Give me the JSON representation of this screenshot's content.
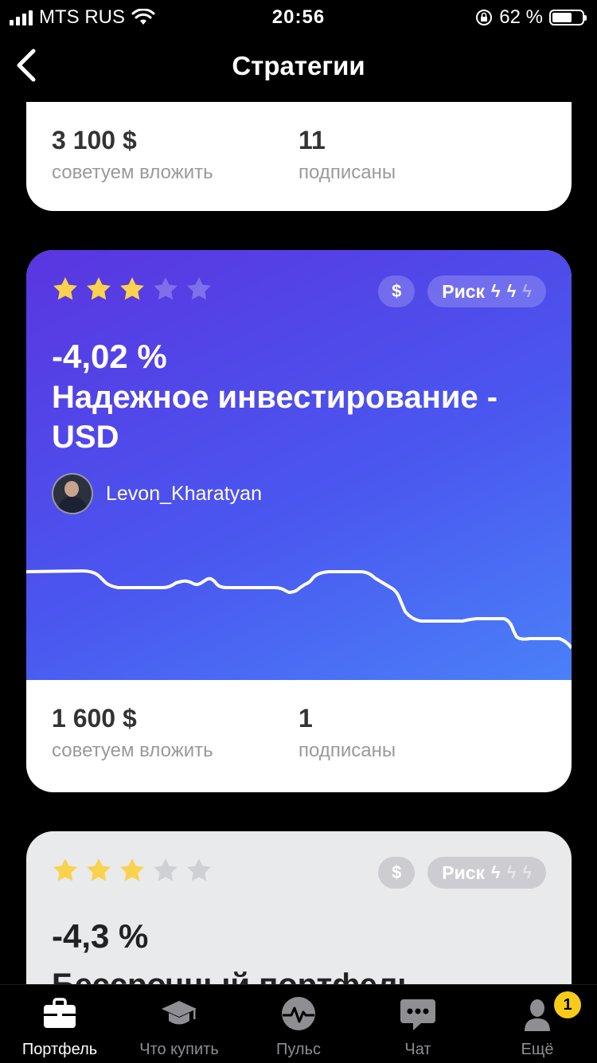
{
  "status": {
    "carrier": "MTS RUS",
    "time": "20:56",
    "battery": "62 %"
  },
  "nav": {
    "title": "Стратегии"
  },
  "cards": [
    {
      "amount": "3 100 $",
      "amount_label": "советуем вложить",
      "subs": "11",
      "subs_label": "подписаны"
    },
    {
      "rating": 3,
      "currency": "$",
      "risk_label": "Риск",
      "risk_level": 2,
      "percent": "-4,02 %",
      "name": "Надежное инвестирование - USD",
      "author": "Levon_Kharatyan",
      "amount": "1 600 $",
      "amount_label": "советуем вложить",
      "subs": "1",
      "subs_label": "подписаны"
    },
    {
      "rating": 3,
      "currency": "$",
      "risk_label": "Риск",
      "risk_level": 1,
      "percent": "-4,3 %",
      "name": "Бессрочный портфель"
    }
  ],
  "tabs": [
    {
      "label": "Портфель",
      "icon": "briefcase-icon",
      "active": true
    },
    {
      "label": "Что купить",
      "icon": "graduation-cap-icon"
    },
    {
      "label": "Пульс",
      "icon": "pulse-icon"
    },
    {
      "label": "Чат",
      "icon": "chat-icon"
    },
    {
      "label": "Ещё",
      "icon": "profile-icon",
      "badge": "1"
    }
  ]
}
